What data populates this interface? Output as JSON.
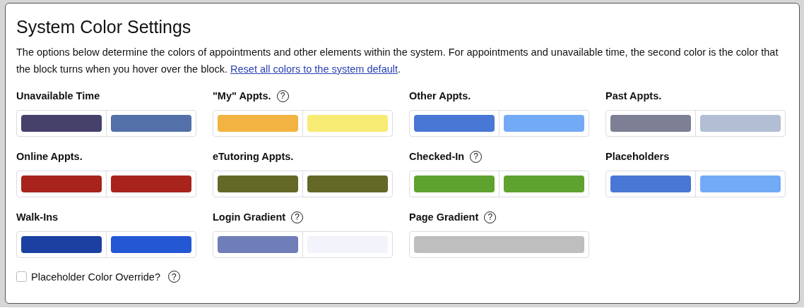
{
  "title": "System Color Settings",
  "description": "The options below determine the colors of appointments and other elements within the system. For appointments and unavailable time, the second color is the color that the block turns when you hover over the block. ",
  "reset_link": "Reset all colors to the system default",
  "description_end": ".",
  "settings": [
    {
      "label": "Unavailable Time",
      "swatches": [
        {
          "color": "#45416b"
        },
        {
          "color": "#5470a8"
        }
      ]
    },
    {
      "label": "\"My\" Appts.",
      "help": "?",
      "swatches": [
        {
          "color": "#f2b342"
        },
        {
          "color": "#f7eb74"
        }
      ]
    },
    {
      "label": "Other Appts.",
      "swatches": [
        {
          "color": "#4877d6"
        },
        {
          "color": "#72aaf5"
        }
      ]
    },
    {
      "label": "Past Appts.",
      "swatches": [
        {
          "color": "#7d7f94"
        },
        {
          "color": "#b1bed3"
        }
      ]
    },
    {
      "label": "Online Appts.",
      "swatches": [
        {
          "color": "#a8231b"
        },
        {
          "color": "#a8231b"
        }
      ]
    },
    {
      "label": "eTutoring Appts.",
      "swatches": [
        {
          "color": "#636827"
        },
        {
          "color": "#636827"
        }
      ]
    },
    {
      "label": "Checked-In",
      "help": "?",
      "swatches": [
        {
          "color": "#5ea22f"
        },
        {
          "color": "#5ea22f"
        }
      ]
    },
    {
      "label": "Placeholders",
      "swatches": [
        {
          "color": "#4877d6"
        },
        {
          "color": "#72aaf5"
        }
      ]
    },
    {
      "label": "Walk-Ins",
      "swatches": [
        {
          "color": "#1b40a2"
        },
        {
          "color": "#2357d3"
        }
      ]
    },
    {
      "label": "Login Gradient",
      "help": "?",
      "swatches": [
        {
          "color": "#6f7db8"
        },
        {
          "color": "#f3f3fb"
        }
      ]
    },
    {
      "label": "Page Gradient",
      "help": "?",
      "swatches": [
        {
          "color": "#bebebe"
        }
      ]
    }
  ],
  "override": {
    "label": "Placeholder Color Override?",
    "checked": false,
    "help": "?"
  }
}
